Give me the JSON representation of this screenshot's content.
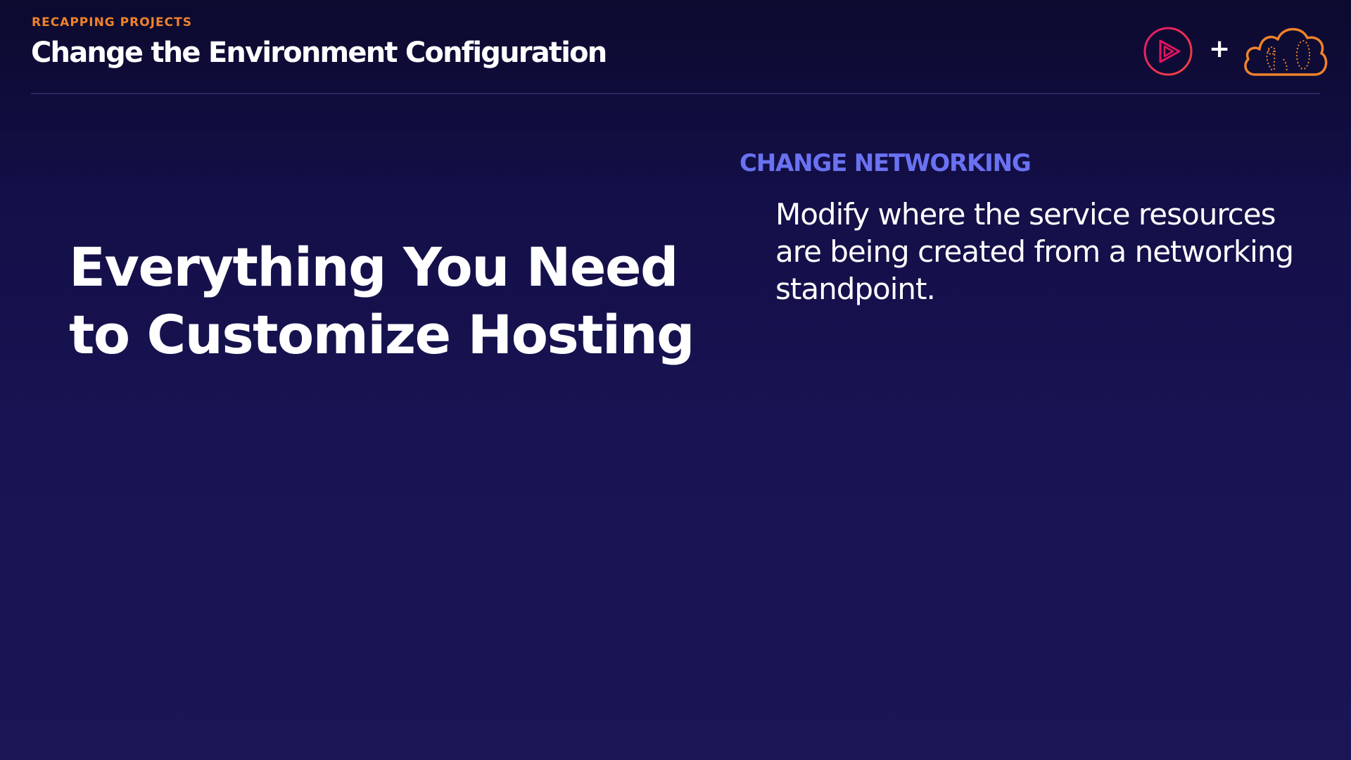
{
  "header": {
    "eyebrow": "RECAPPING PROJECTS",
    "title": "Change the Environment Configuration",
    "plus_sign": "+"
  },
  "logos": {
    "left": {
      "icon": "pluralsight-play-icon",
      "color": "#e3145f"
    },
    "right": {
      "icon": "cloud-icon",
      "color": "#f0822b"
    }
  },
  "hero": {
    "line1": "Everything You Need",
    "line2": "to Customize Hosting"
  },
  "section": {
    "heading": "CHANGE NETWORKING",
    "body": "Modify where the service resources are being created from a networking standpoint."
  },
  "colors": {
    "accent_orange": "#f0822b",
    "accent_blue": "#6a72f2",
    "accent_pink": "#e3145f",
    "background": "#181352"
  }
}
